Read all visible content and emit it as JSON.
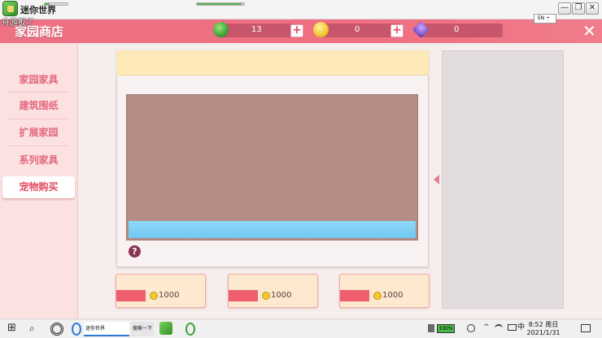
{
  "window": {
    "title": "迷你世界",
    "controls": {
      "minimize": "—",
      "restore": "❐",
      "close": "✕"
    }
  },
  "header": {
    "shop_title": "家园商店",
    "overlay_text": "舟游板了",
    "currencies": [
      {
        "name": "green-gem",
        "value": "13",
        "color": "#3ea53c"
      },
      {
        "name": "gold-coin",
        "value": "0",
        "color": "#f3c52e"
      },
      {
        "name": "purple-gem",
        "value": "0",
        "color": "#8a5cd0"
      }
    ],
    "plus_label": "+",
    "lang": "EN ÷",
    "close": "✕"
  },
  "nav": {
    "items": [
      {
        "label": "家园家具",
        "active": false
      },
      {
        "label": "建筑围纸",
        "active": false
      },
      {
        "label": "扩展家园",
        "active": false
      },
      {
        "label": "系列家具",
        "active": false
      },
      {
        "label": "宠物购买",
        "active": true
      }
    ]
  },
  "main": {
    "help": "?",
    "price_cards": [
      {
        "price": "1000"
      },
      {
        "price": "1000"
      },
      {
        "price": "1000"
      }
    ]
  },
  "taskbar": {
    "start": "⊞",
    "search_icon": "⌕",
    "tabs": [
      {
        "label": "迷你世界"
      },
      {
        "label": "搜索一下"
      }
    ],
    "battery": "100%",
    "ime": "中",
    "clock_time": "8:52 周日",
    "clock_date": "2021/1/31"
  },
  "colors": {
    "accent": "#ee7184",
    "nav_text": "#e3697e",
    "card_head": "#fde8b8",
    "preview": "#b68d85",
    "preview_bar": "#78cdf3"
  }
}
